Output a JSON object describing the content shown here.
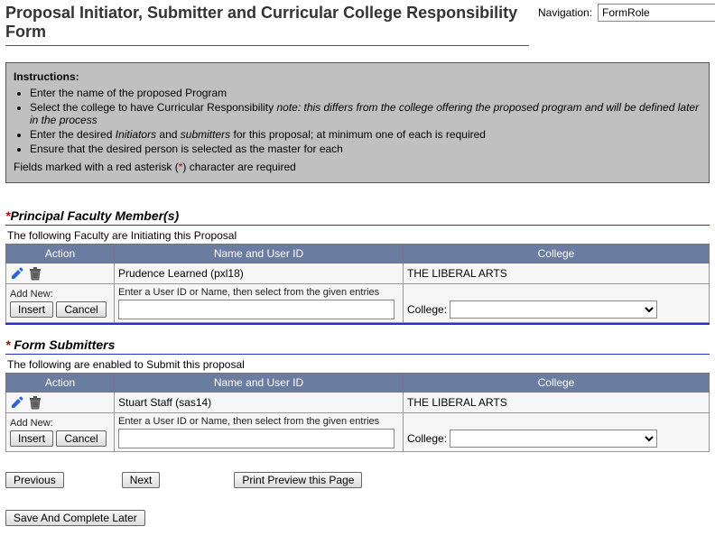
{
  "header": {
    "title": "Proposal Initiator, Submitter and Curricular College Responsibility Form",
    "nav_label": "Navigation:",
    "nav_value": "FormRole"
  },
  "instructions": {
    "heading": "Instructions:",
    "items": [
      {
        "text": "Enter the name of the proposed Program"
      },
      {
        "prefix": "Select the college to have Curricular Responsibility ",
        "note": "note: this differs from the college offering the proposed program and will be defined later in the process"
      },
      {
        "prefix": "Enter the desired ",
        "em1": "Initiators",
        "mid": " and ",
        "em2": "submitters",
        "suffix": " for this proposal; at minimum one of each is required"
      },
      {
        "text": "Ensure that the desired person is selected as the master for each"
      }
    ],
    "required_note_pre": "Fields marked with a red asterisk (",
    "required_note_ast": "*",
    "required_note_post": ") character are required"
  },
  "faculty": {
    "title": "Principal Faculty Member(s)",
    "ast": "*",
    "subtitle": "The following Faculty are Initiating this Proposal",
    "columns": {
      "action": "Action",
      "name": "Name and User ID",
      "college": "College"
    },
    "rows": [
      {
        "name": "Prudence Learned (pxl18)",
        "college": "THE LIBERAL ARTS"
      }
    ],
    "add_label": "Add New:",
    "hint": "Enter a User ID or Name, then select from the given entries",
    "insert_label": "Insert",
    "cancel_label": "Cancel",
    "college_label": "College:"
  },
  "submitters": {
    "title": " Form Submitters",
    "ast": "*",
    "subtitle": "The following are enabled to Submit this proposal",
    "columns": {
      "action": "Action",
      "name": "Name and User ID",
      "college": "College"
    },
    "rows": [
      {
        "name": "Stuart Staff (sas14)",
        "college": "THE LIBERAL ARTS"
      }
    ],
    "add_label": "Add New:",
    "hint": "Enter a User ID or Name, then select from the given entries",
    "insert_label": "Insert",
    "cancel_label": "Cancel",
    "college_label": "College:"
  },
  "buttons": {
    "previous": "Previous",
    "next": "Next",
    "print": "Print Preview this Page",
    "save": "Save And Complete Later"
  }
}
